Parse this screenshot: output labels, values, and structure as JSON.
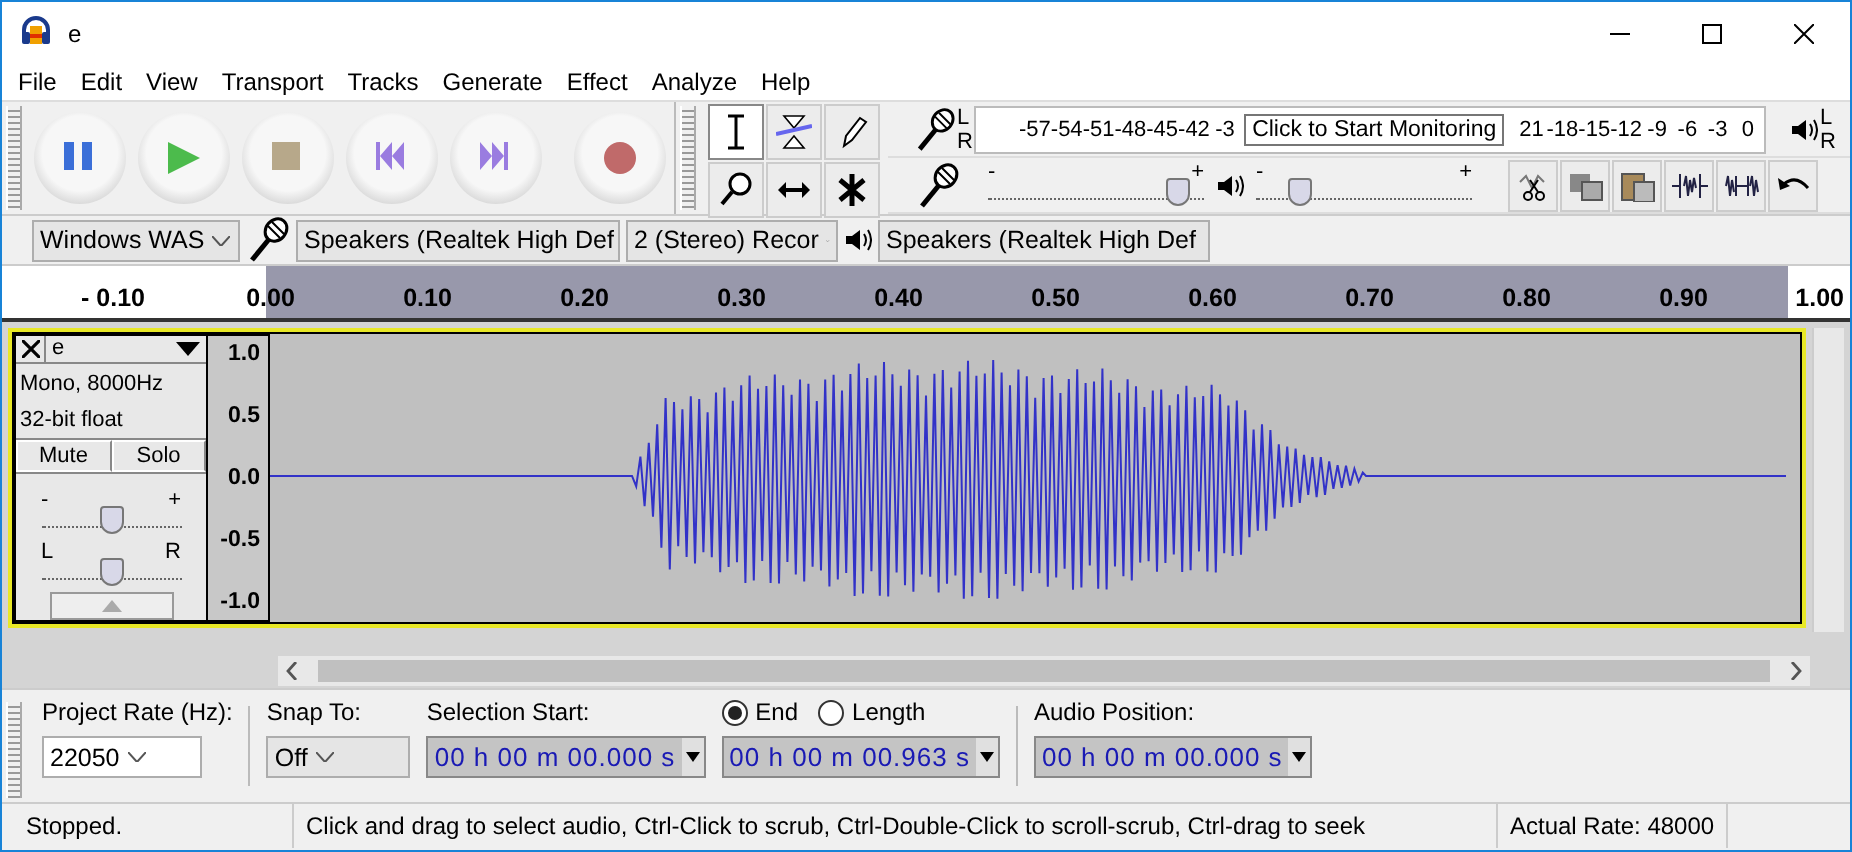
{
  "window": {
    "title": "e"
  },
  "menu": [
    "File",
    "Edit",
    "View",
    "Transport",
    "Tracks",
    "Generate",
    "Effect",
    "Analyze",
    "Help"
  ],
  "transport": [
    {
      "kind": "pause"
    },
    {
      "kind": "play"
    },
    {
      "kind": "stop"
    },
    {
      "kind": "skip-start"
    },
    {
      "kind": "skip-end"
    },
    {
      "kind": "record"
    }
  ],
  "tools": [
    {
      "kind": "select",
      "selected": true
    },
    {
      "kind": "envelope",
      "selected": false
    },
    {
      "kind": "draw",
      "selected": false
    },
    {
      "kind": "zoom",
      "selected": false
    },
    {
      "kind": "timeshift",
      "selected": false
    },
    {
      "kind": "multi",
      "selected": false
    }
  ],
  "recording_meter": {
    "channels": [
      "L",
      "R"
    ],
    "scale_before": [
      "-57",
      "-54",
      "-51",
      "-48",
      "-45",
      "-42",
      "-3"
    ],
    "tooltip": "Click to Start Monitoring",
    "scale_after": [
      "21",
      "-18",
      "-15",
      "-12",
      "-9",
      "-6",
      "-3",
      "0"
    ]
  },
  "playback_meter": {
    "channels": [
      "L",
      "R"
    ]
  },
  "mixer": {
    "record_volume": {
      "min_label": "-",
      "max_label": "+",
      "level": 0.88
    },
    "playback_volume": {
      "min_label": "-",
      "max_label": "+",
      "level": 0.2
    }
  },
  "edit_tools": [
    {
      "kind": "cut"
    },
    {
      "kind": "copy"
    },
    {
      "kind": "paste"
    },
    {
      "kind": "trim"
    },
    {
      "kind": "silence"
    },
    {
      "kind": "undo"
    }
  ],
  "device_toolbar": {
    "host": "Windows WAS",
    "recording_device": "Speakers (Realtek High Def",
    "recording_channels": "2 (Stereo) Recor",
    "playback_device": "Speakers (Realtek High Def"
  },
  "ruler": {
    "labels": [
      "- 0.10",
      "0.00",
      "0.10",
      "0.20",
      "0.30",
      "0.40",
      "0.50",
      "0.60",
      "0.70",
      "0.80",
      "0.90",
      "1.00"
    ]
  },
  "track": {
    "name": "e",
    "info": [
      "Mono, 8000Hz",
      "32-bit float"
    ],
    "buttons": [
      "Mute",
      "Solo"
    ],
    "focused": true,
    "gain": {
      "min_label": "-",
      "max_label": "+",
      "level": 0.5
    },
    "pan": {
      "min_label": "L",
      "max_label": "R",
      "level": 0.5
    },
    "scale": [
      "1.0",
      "0.5",
      "0.0",
      "-0.5",
      "-1.0"
    ]
  },
  "selection_toolbar": {
    "project_rate": {
      "label": "Project Rate (Hz):",
      "value": "22050"
    },
    "snap_to": {
      "label": "Snap To:",
      "value": "Off"
    },
    "selection_start": {
      "label": "Selection Start:",
      "value": "00 h 00 m 00.000 s"
    },
    "end_mode": [
      {
        "label": "End",
        "selected": true
      },
      {
        "label": "Length",
        "selected": false
      }
    ],
    "end_value": "00 h 00 m 00.963 s",
    "audio_position": {
      "label": "Audio Position:",
      "value": "00 h 00 m 00.000 s"
    }
  },
  "status_bar": {
    "state": "Stopped.",
    "hint": "Click and drag to select audio, Ctrl-Click to scrub, Ctrl-Double-Click to scroll-scrub, Ctrl-drag to seek",
    "rate": "Actual Rate: 48000"
  }
}
